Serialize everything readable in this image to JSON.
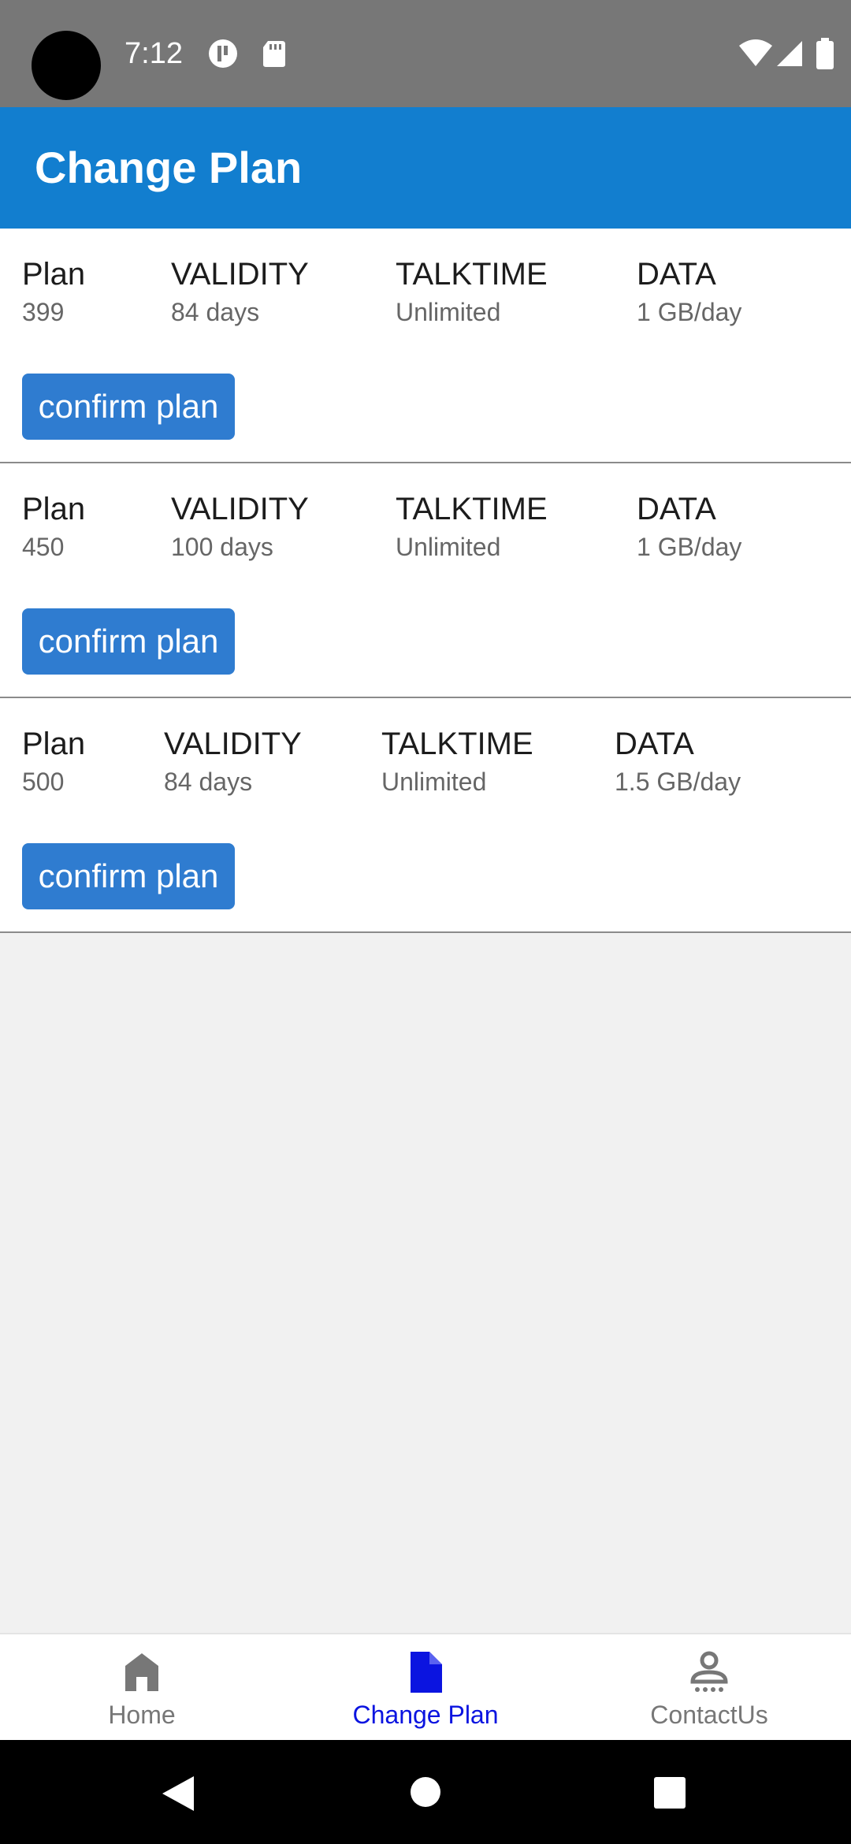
{
  "status_bar": {
    "time": "7:12",
    "icons": [
      "camera-cutout",
      "media-icon",
      "sd-card-icon",
      "wifi-icon",
      "signal-icon",
      "battery-icon"
    ]
  },
  "app_bar": {
    "title": "Change Plan"
  },
  "plans": [
    {
      "plan_label": "Plan",
      "plan_value": "399",
      "validity_label": "VALIDITY",
      "validity_value": "84 days",
      "talktime_label": "TALKTIME",
      "talktime_value": "Unlimited",
      "data_label": "DATA",
      "data_value": "1 GB/day",
      "button_label": "confirm plan"
    },
    {
      "plan_label": "Plan",
      "plan_value": "450",
      "validity_label": "VALIDITY",
      "validity_value": "100 days",
      "talktime_label": "TALKTIME",
      "talktime_value": "Unlimited",
      "data_label": "DATA",
      "data_value": "1 GB/day",
      "button_label": "confirm plan"
    },
    {
      "plan_label": "Plan",
      "plan_value": "500",
      "validity_label": "VALIDITY",
      "validity_value": "84 days",
      "talktime_label": "TALKTIME",
      "talktime_value": "Unlimited",
      "data_label": "DATA",
      "data_value": "1.5 GB/day",
      "button_label": "confirm plan"
    }
  ],
  "bottom_nav": {
    "items": [
      {
        "label": "Home",
        "icon": "home-icon",
        "active": false
      },
      {
        "label": "Change Plan",
        "icon": "document-icon",
        "active": true
      },
      {
        "label": "ContactUs",
        "icon": "contact-icon",
        "active": false
      }
    ]
  },
  "system_nav": {
    "icons": [
      "back-icon",
      "home-circle-icon",
      "recents-icon"
    ]
  },
  "colors": {
    "status_bar": "#777777",
    "app_bar": "#127ecf",
    "button": "#2f7cd0",
    "active_nav": "#0b14e0",
    "inactive_nav": "#777777"
  }
}
